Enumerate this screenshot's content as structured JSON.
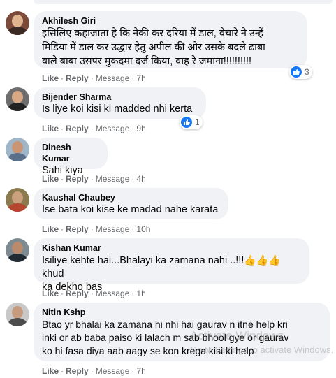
{
  "colors": {
    "like_blue": "#1877f2",
    "bubble_bg": "#f0f2f5",
    "meta_text": "#65676b"
  },
  "actions": {
    "like": "Like",
    "reply": "Reply",
    "message": "Message",
    "sep": "·"
  },
  "comments": [
    {
      "author": "Akhilesh Giri",
      "text": "इसिलिए कहाजाता है कि नेकी कर दरिया में डाल, वेचारे ने उन्हें\nमिडिया में डाल कर उद्धार हेतु अपील की और उसके बदले ढाबा\nवाले बाबा उसपर मुकदमा दर्ज किया, वाह रे जमाना!!!!!!!!!!",
      "time": "7h",
      "reactions": "3"
    },
    {
      "author": "Bijender Sharma",
      "text": "Is liye koi kisi ki madded nhi kerta",
      "time": "9h",
      "reactions": "1"
    },
    {
      "author": "Dinesh Kumar",
      "text": "Sahi kiya",
      "time": "4h"
    },
    {
      "author": "Kaushal Chaubey",
      "text": "Ise bata koi kise ke madad nahe karata",
      "time": "10h"
    },
    {
      "author": "Kishan Kumar",
      "text_before": "Isiliye kehte hai...Bhalayi ka zamana nahi ..!!!",
      "emoji": "👍👍👍",
      "text_after": " khud\nka dekho bas",
      "time": "1h"
    },
    {
      "author": "Nitin Kshp",
      "text": "Btao yr bhalai ka zamana hi nhi hai gaurav n itne help kri\ninki or ab baba paiso ki lalach m sab bhool gye or gaurav\nko hi fasa diya aab aagy se kon krega kisi ki help",
      "time": "7h"
    }
  ],
  "watermark": {
    "title": "Activate Windows",
    "subtitle": "Go to Settings to activate Windows."
  }
}
